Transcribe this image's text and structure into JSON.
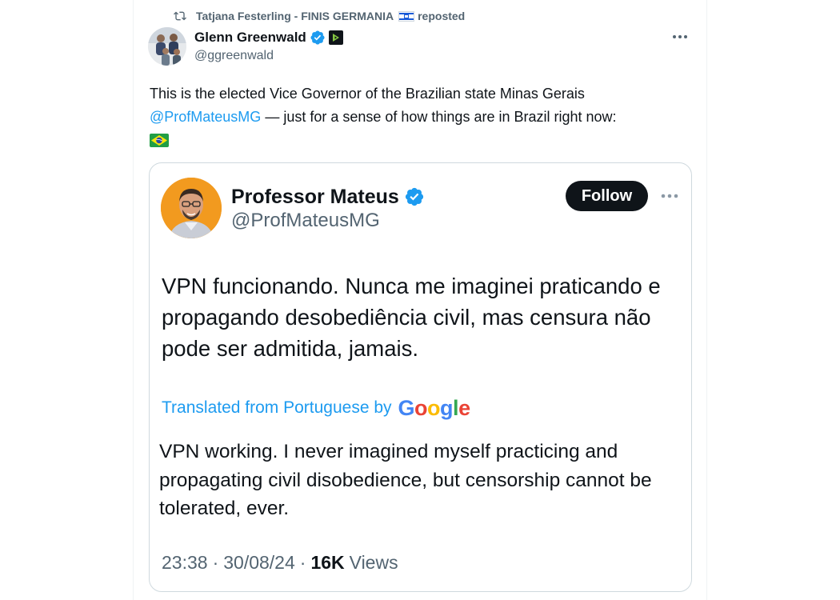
{
  "repost": {
    "reposter": "Tatjana Festerling - FINIS GERMANIA",
    "action": "reposted"
  },
  "post": {
    "author_name": "Glenn Greenwald",
    "author_handle": "@ggreenwald",
    "text_part1": "This is the elected Vice Governor of the Brazilian state Minas Gerais",
    "mention": "@ProfMateusMG",
    "text_part2": " — just for a sense of how things are in Brazil right now:"
  },
  "embedded": {
    "name": "Professor Mateus",
    "handle": "@ProfMateusMG",
    "follow_label": "Follow",
    "original_text": "VPN funcionando. Nunca me imaginei praticando e propagando desobediência civil, mas censura não pode ser admitida, jamais.",
    "translated_label": "Translated from Portuguese by",
    "translator": "Google",
    "translated_text": "VPN working. I never imagined myself practicing and propagating civil disobedience, but censorship cannot be tolerated, ever.",
    "time": "23:38",
    "date": "30/08/24",
    "views_count": "16K",
    "views_label": "Views"
  },
  "colors": {
    "accent": "#1d9bf0",
    "text": "#0f1419",
    "muted": "#536471",
    "verified": "#1d9bf0",
    "follow_bg": "#0f1419"
  },
  "icons": {
    "repost": "repost-icon",
    "verified": "verified-badge-icon",
    "affiliate": "rumble-badge-icon",
    "more": "more-icon",
    "flag_israel": "israel-flag-icon",
    "flag_brazil": "brazil-flag-icon"
  }
}
